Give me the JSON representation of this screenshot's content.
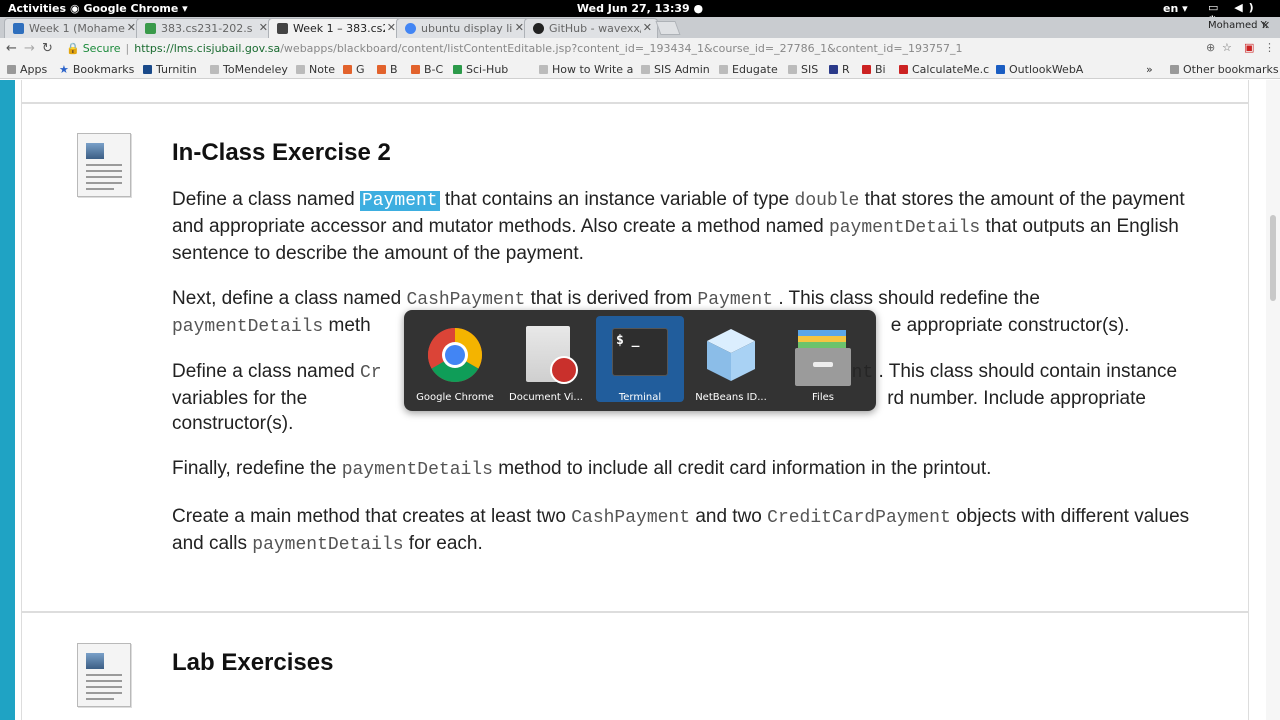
{
  "topbar": {
    "activities": "Activities",
    "app": "Google Chrome ▾",
    "clock": "Wed Jun 27, 13:39 ●",
    "lang": "en ▾",
    "sys": "▭ ◀) ⏻ ▾"
  },
  "tabs": [
    {
      "label": "Week 1 (Mohame",
      "fav_color": "#2f6fbd",
      "active": false
    },
    {
      "label": "383.cs231-202.s",
      "fav_color": "#3a9a4a",
      "active": false
    },
    {
      "label": "Week 1 – 383.cs2",
      "fav_color": "#444444",
      "active": true
    },
    {
      "label": "ubuntu display li",
      "fav_color": "#4285f4",
      "active": false
    },
    {
      "label": "GitHub - wavexx/",
      "fav_color": "#222222",
      "active": false
    }
  ],
  "profile_name": "Mohamed Y.",
  "omnibox": {
    "secure": "Secure",
    "host_prefix": "https://",
    "host": "lms.cisjubail.gov.sa",
    "path": "/webapps/blackboard/content/listContentEditable.jsp?content_id=_193434_1&course_id=_27786_1&content_id=_193757_1"
  },
  "bookmarks": [
    {
      "label": "Apps",
      "color": "#888888"
    },
    {
      "label": "Bookmarks",
      "color": "#2a62c9"
    },
    {
      "label": "Turnitin",
      "color": "#1a4a8a"
    },
    {
      "label": "ToMendeley",
      "color": "#888888"
    },
    {
      "label": "Note",
      "color": "#888888"
    },
    {
      "label": "G",
      "color": "#e2622c"
    },
    {
      "label": "B",
      "color": "#e2622c"
    },
    {
      "label": "B-C",
      "color": "#e2622c"
    },
    {
      "label": "Sci-Hub",
      "color": "#2c9a4a"
    },
    {
      "label": "How to Write a",
      "color": "#888888"
    },
    {
      "label": "SIS Admin",
      "color": "#888888"
    },
    {
      "label": "Edugate",
      "color": "#888888"
    },
    {
      "label": "SIS",
      "color": "#888888"
    },
    {
      "label": "R",
      "color": "#2b3a8a"
    },
    {
      "label": "Bi",
      "color": "#c22"
    },
    {
      "label": "CalculateMe.c",
      "color": "#c22"
    },
    {
      "label": "OutlookWebA",
      "color": "#1a5dc2"
    }
  ],
  "bookmarks_more": "»",
  "other_bookmarks": "Other bookmarks",
  "section1": {
    "title": "In-Class Exercise 2",
    "p1": {
      "a": "Define a class named ",
      "code1": "Payment",
      "b": " that contains an instance variable of type ",
      "code2": "double",
      "c": " that stores the amount of the payment and appropriate accessor and mutator methods. Also create a method named ",
      "code3": "paymentDetails",
      "d": " that outputs an English sentence to describe the amount of the payment."
    },
    "p2": {
      "a": "Next, define a class named ",
      "code1": "CashPayment",
      "b": " that is derived from ",
      "code2": "Payment",
      "c": " . This class should redefine the ",
      "code3": "paymentDetails",
      "d": " meth",
      "e": "e appropriate constructor(s)."
    },
    "p3": {
      "a": "Define a class named ",
      "code1": "Cr",
      "b": "nt",
      "c": " . This class should contain instance variables for the",
      "d": "rd number. Include appropriate constructor(s)."
    },
    "p4": {
      "a": "Finally, redefine the ",
      "code1": "paymentDetails",
      "b": " method to include all credit card information in the printout."
    },
    "p5": {
      "a": "Create a main method that creates at least two ",
      "code1": "CashPayment",
      "b": " and two ",
      "code2": "CreditCardPayment",
      "c": " objects with different values and calls ",
      "code3": "paymentDetails",
      "d": " for each."
    }
  },
  "section2": {
    "title": "Lab Exercises"
  },
  "switcher": [
    {
      "label": "Google Chrome",
      "icon": "chrome-icon",
      "selected": false
    },
    {
      "label": "Document Vi...",
      "icon": "document-viewer-icon",
      "selected": false
    },
    {
      "label": "Terminal",
      "icon": "terminal-icon",
      "selected": true
    },
    {
      "label": "NetBeans ID...",
      "icon": "netbeans-icon",
      "selected": false
    },
    {
      "label": "Files",
      "icon": "files-icon",
      "selected": false
    }
  ],
  "terminal_glyph": "$ _",
  "colors": {
    "accent": "#1fa3c4",
    "switch_sel": "#215d9c",
    "highlight": "#3daee0"
  }
}
